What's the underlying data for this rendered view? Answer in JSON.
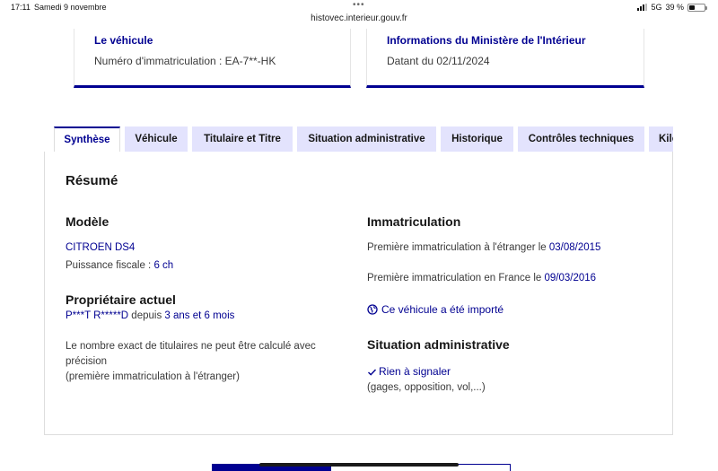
{
  "status_bar": {
    "time": "17:11",
    "date": "Samedi 9 novembre",
    "url": "histovec.interieur.gouv.fr",
    "network": "5G",
    "battery": "39 %",
    "battery_level": 0.39
  },
  "cards": {
    "vehicle": {
      "title": "Le véhicule",
      "text": "Numéro d'immatriculation : EA-7**-HK"
    },
    "ministry": {
      "title": "Informations du Ministère de l'Intérieur",
      "text": "Datant du 02/11/2024"
    }
  },
  "tabs": [
    {
      "label": "Synthèse",
      "active": true
    },
    {
      "label": "Véhicule",
      "active": false
    },
    {
      "label": "Titulaire et Titre",
      "active": false
    },
    {
      "label": "Situation administrative",
      "active": false
    },
    {
      "label": "Historique",
      "active": false
    },
    {
      "label": "Contrôles techniques",
      "active": false
    },
    {
      "label": "Kilo",
      "active": false
    }
  ],
  "summary": {
    "title": "Résumé",
    "modele": {
      "heading": "Modèle",
      "name": "CITROEN DS4",
      "puissance_label": "Puissance fiscale : ",
      "puissance_value": "6 ch"
    },
    "proprietaire": {
      "heading": "Propriétaire actuel",
      "name": "P***T R*****D",
      "depuis_label": " depuis ",
      "duree": "3 ans et 6 mois",
      "note_line1": "Le nombre exact de titulaires ne peut être calculé avec",
      "note_line2": "précision",
      "note_line3": "(première immatriculation à l'étranger)"
    },
    "immatriculation": {
      "heading": "Immatriculation",
      "etranger_label": "Première immatriculation à l'étranger le ",
      "etranger_date": "03/08/2015",
      "france_label": "Première immatriculation en France le ",
      "france_date": "09/03/2016",
      "importe_link": "Ce véhicule a été importé"
    },
    "situation": {
      "heading": "Situation administrative",
      "status": "Rien à signaler",
      "details": "(gages, opposition, vol,...)"
    }
  },
  "colors": {
    "accent": "#000091",
    "tab_bg": "#e3e3fd",
    "text": "#3a3a3a"
  }
}
